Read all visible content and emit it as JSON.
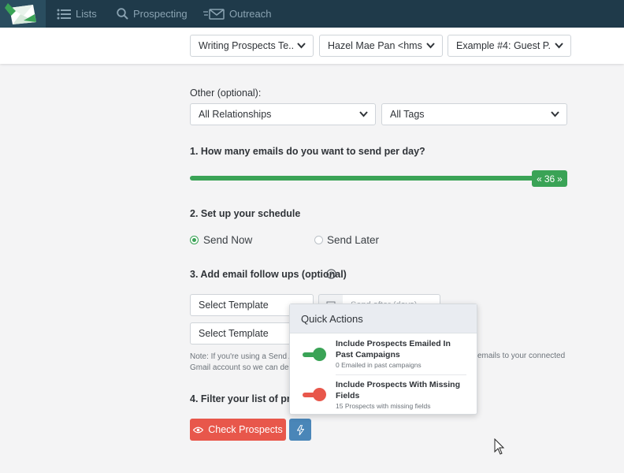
{
  "nav": {
    "items": [
      {
        "label": "Lists",
        "icon": "list-icon"
      },
      {
        "label": "Prospecting",
        "icon": "search-icon"
      },
      {
        "label": "Outreach",
        "icon": "envelope-icon"
      }
    ]
  },
  "toolbar": {
    "dropdowns": [
      {
        "value": "Writing Prospects Te..."
      },
      {
        "value": "Hazel Mae Pan <hms..."
      },
      {
        "value": "Example #4: Guest P..."
      }
    ]
  },
  "filters": {
    "label": "Other (optional):",
    "relationships": "All Relationships",
    "tags": "All Tags"
  },
  "step1": {
    "label": "1. How many emails do you want to send per day?",
    "value": "36"
  },
  "step2": {
    "label": "2. Set up your schedule",
    "send_now": "Send Now",
    "send_later": "Send Later"
  },
  "step3": {
    "label": "3. Add email follow ups (optional)",
    "template1": "Select Template",
    "template2": "Select Template",
    "date_placeholder": "Send after (days)",
    "note_left": "Note: If you're using a Send A",
    "note_right": "emails to your connected",
    "note_line2": "Gmail account so we can dead"
  },
  "step4": {
    "label": "4. Filter your list of prosp",
    "check_button": "Check Prospects"
  },
  "quick_actions": {
    "title": "Quick Actions",
    "items": [
      {
        "title": "Include Prospects Emailed In Past Campaigns",
        "sub": "0 Emailed in past campaigns",
        "state": "on",
        "color": "#3aa356"
      },
      {
        "title": "Include Prospects With Missing Fields",
        "sub": "15 Prospects with missing fields",
        "state": "off",
        "color": "#e8574b"
      }
    ]
  },
  "colors": {
    "accent_green": "#3aa356",
    "accent_red": "#e8574b",
    "topbar": "#1f3a4a"
  }
}
